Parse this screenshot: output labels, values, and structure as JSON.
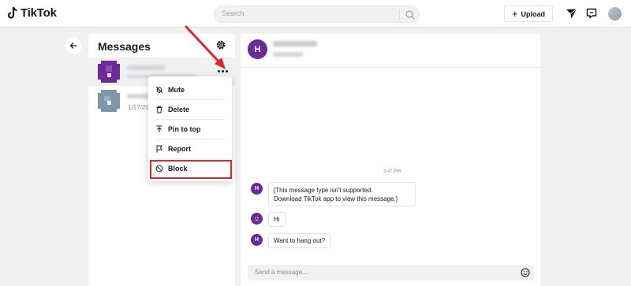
{
  "app": {
    "name": "TikTok"
  },
  "header": {
    "search_placeholder": "Search",
    "upload_label": "Upload"
  },
  "messages": {
    "title": "Messages",
    "conversations": [
      {
        "date": "",
        "active": true
      },
      {
        "date": "1/17/202",
        "active": false
      }
    ]
  },
  "context_menu": {
    "items": [
      {
        "label": "Mute",
        "icon": "mute-icon"
      },
      {
        "label": "Delete",
        "icon": "trash-icon"
      },
      {
        "label": "Pin to top",
        "icon": "pin-icon"
      },
      {
        "label": "Report",
        "icon": "flag-icon"
      },
      {
        "label": "Block",
        "icon": "block-icon"
      }
    ]
  },
  "chat": {
    "avatar_letter": "H",
    "timestamp": "3:47 PM",
    "messages": [
      {
        "line1": "[This message type isn't supported.",
        "line2": "Download TikTok app to view this message.]"
      },
      {
        "text": "Hi"
      },
      {
        "text": "Want to hang out?"
      }
    ],
    "input_placeholder": "Send a message..."
  },
  "colors": {
    "accent_purple": "#6b2a95",
    "annotation_red": "#e0262c"
  }
}
